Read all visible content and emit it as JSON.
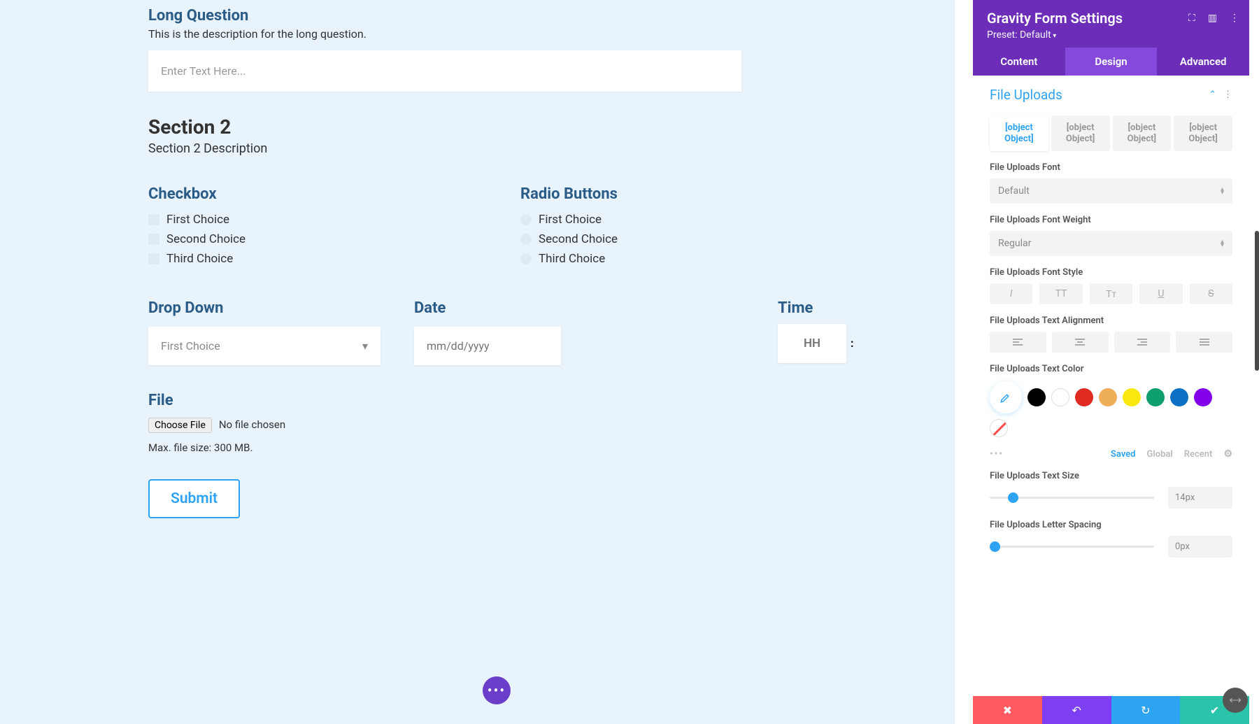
{
  "form": {
    "long_q_title": "Long Question",
    "long_q_desc": "This is the description for the long question.",
    "long_q_placeholder": "Enter Text Here...",
    "section2_title": "Section 2",
    "section2_desc": "Section 2 Description",
    "checkbox": {
      "title": "Checkbox",
      "options": [
        "First Choice",
        "Second Choice",
        "Third Choice"
      ]
    },
    "radio": {
      "title": "Radio Buttons",
      "options": [
        "First Choice",
        "Second Choice",
        "Third Choice"
      ]
    },
    "dropdown": {
      "title": "Drop Down",
      "value": "First Choice"
    },
    "date": {
      "title": "Date",
      "placeholder": "mm/dd/yyyy"
    },
    "time": {
      "title": "Time",
      "hh": "HH",
      "sep": ":"
    },
    "file": {
      "title": "File",
      "button": "Choose File",
      "status": "No file chosen",
      "max": "Max. file size: 300 MB."
    },
    "submit": "Submit"
  },
  "panel": {
    "title": "Gravity Form Settings",
    "preset": "Preset: Default",
    "tabs": [
      "Content",
      "Design",
      "Advanced"
    ],
    "section": "File Uploads",
    "obj_tabs": [
      "[object Object]",
      "[object Object]",
      "[object Object]",
      "[object Object]"
    ],
    "font_label": "File Uploads Font",
    "font_value": "Default",
    "weight_label": "File Uploads Font Weight",
    "weight_value": "Regular",
    "style_label": "File Uploads Font Style",
    "align_label": "File Uploads Text Alignment",
    "color_label": "File Uploads Text Color",
    "colors": [
      "#000000",
      "#ffffff",
      "#e02b20",
      "#edb059",
      "#f9e80e",
      "#0d9e6d",
      "#0c71c3",
      "#8300e9"
    ],
    "saved_tabs": {
      "saved": "Saved",
      "global": "Global",
      "recent": "Recent"
    },
    "size_label": "File Uploads Text Size",
    "size_value": "14px",
    "spacing_label": "File Uploads Letter Spacing",
    "spacing_value": "0px"
  }
}
